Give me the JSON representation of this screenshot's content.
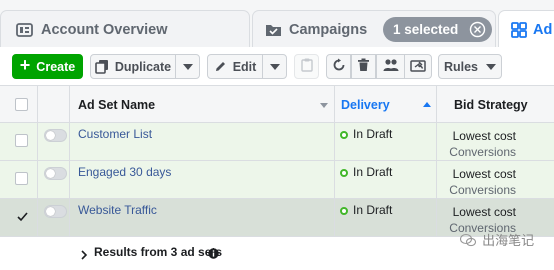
{
  "tabs": {
    "account_overview": "Account Overview",
    "campaigns": "Campaigns",
    "selected_pill": "1 selected",
    "ad_sets_partial": "Ad S"
  },
  "toolbar": {
    "create_label": "Create",
    "duplicate_label": "Duplicate",
    "edit_label": "Edit",
    "rules_label": "Rules",
    "icons": [
      "plus-icon",
      "duplicate-icon",
      "pencil-icon",
      "paste-icon",
      "reload-icon",
      "trash-icon",
      "people-icon",
      "share-icon",
      "chevron-down-icon"
    ]
  },
  "table": {
    "headers": {
      "ad_set_name": "Ad Set Name",
      "delivery": "Delivery",
      "bid_strategy": "Bid Strategy"
    },
    "rows": [
      {
        "name": "Customer List",
        "delivery": "In Draft",
        "bid": "Lowest cost",
        "bid_sub": "Conversions",
        "selected": false
      },
      {
        "name": "Engaged 30 days",
        "delivery": "In Draft",
        "bid": "Lowest cost",
        "bid_sub": "Conversions",
        "selected": false
      },
      {
        "name": "Website Traffic",
        "delivery": "In Draft",
        "bid": "Lowest cost",
        "bid_sub": "Conversions",
        "selected": true
      }
    ],
    "summary": "Results from 3 ad sets"
  },
  "watermark": "出海笔记",
  "colors": {
    "create_green": "#00a400",
    "accent_blue": "#1877f2",
    "link_blue": "#385898",
    "status_green": "#42b72a",
    "row_highlight": "#edf6ea",
    "row_selected": "#d8e0d8"
  }
}
